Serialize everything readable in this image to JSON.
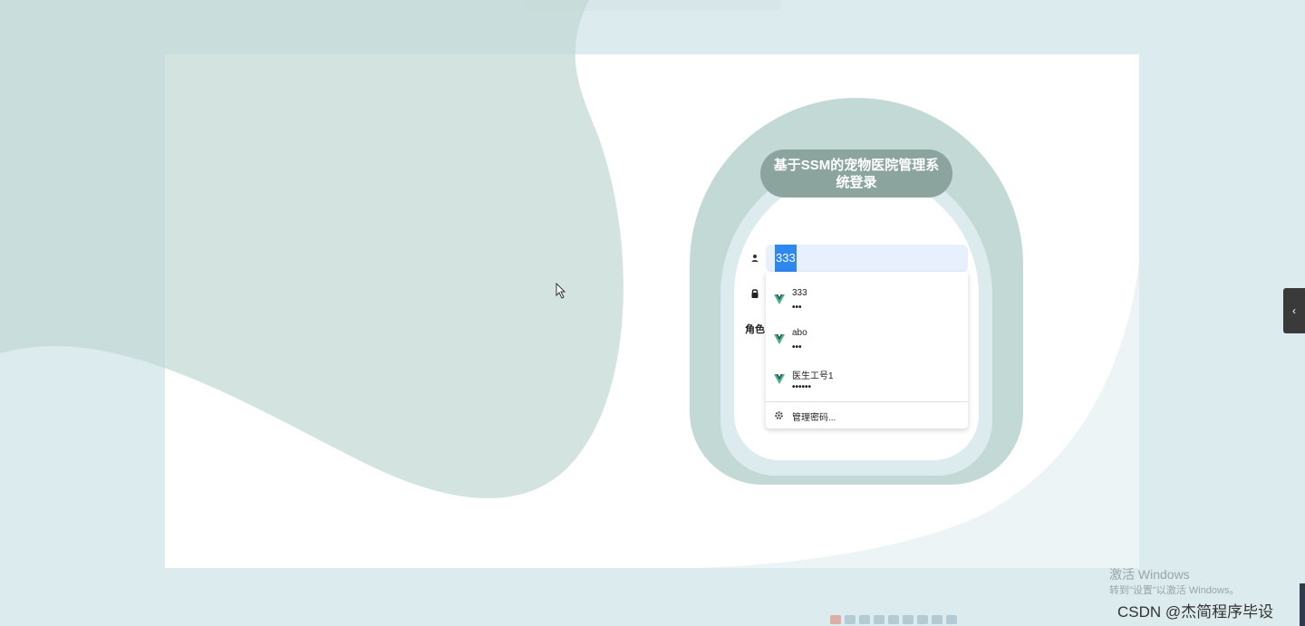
{
  "login": {
    "title": "基于SSM的宠物医院管理系统登录",
    "username_value": "333",
    "role_label": "角色"
  },
  "autofill": {
    "items": [
      {
        "username": "333",
        "password_mask": "•••"
      },
      {
        "username": "abo",
        "password_mask": "•••"
      },
      {
        "username": "医生工号1",
        "password_mask": "••••••"
      }
    ],
    "manage_label": "管理密码..."
  },
  "watermark": {
    "windows_title": "激活 Windows",
    "windows_sub": "转到\"设置\"以激活 Windows。",
    "csdn": "CSDN @杰简程序毕设"
  },
  "icons": {
    "user": "user-icon",
    "lock": "lock-icon",
    "autofill_logo": "vue-logo-icon",
    "settings": "gear-icon",
    "collapse": "chevron-left-icon",
    "cursor": "mouse-cursor-icon"
  },
  "colors": {
    "background": "#dcebee",
    "blob": "#c3d9d6",
    "title_pill": "#8ba49e",
    "input_bg": "#e8f0fe",
    "selection": "#2f87f0"
  }
}
